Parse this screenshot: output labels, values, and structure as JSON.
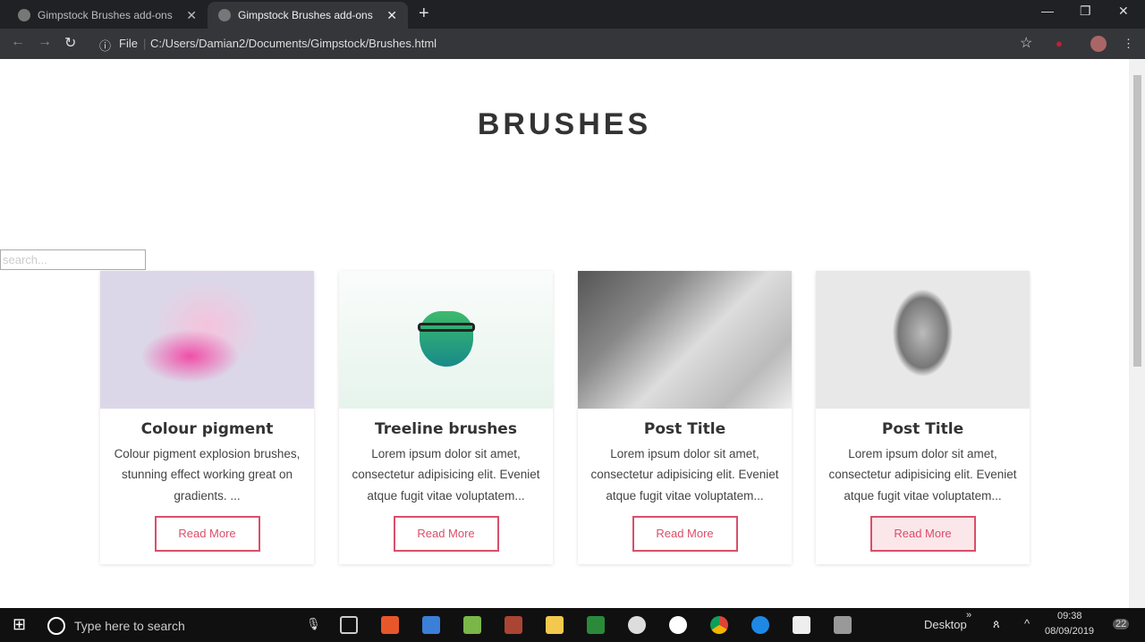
{
  "browser": {
    "tabs": [
      {
        "title": "Gimpstock Brushes add-ons"
      },
      {
        "title": "Gimpstock Brushes add-ons"
      }
    ],
    "address_scheme": "File",
    "url": "C:/Users/Damian2/Documents/Gimpstock/Brushes.html"
  },
  "page": {
    "title": "BRUSHES",
    "search_placeholder": "search...",
    "cards": [
      {
        "title": "Colour pigment",
        "text": "Colour pigment explosion brushes, stunning effect working great on gradients. ...",
        "button": "Read More"
      },
      {
        "title": "Treeline brushes",
        "text": "Lorem ipsum dolor sit amet, consectetur adipisicing elit. Eveniet atque fugit vitae voluptatem...",
        "button": "Read More"
      },
      {
        "title": "Post Title",
        "text": "Lorem ipsum dolor sit amet, consectetur adipisicing elit. Eveniet atque fugit vitae voluptatem...",
        "button": "Read More"
      },
      {
        "title": "Post Title",
        "text": "Lorem ipsum dolor sit amet, consectetur adipisicing elit. Eveniet atque fugit vitae voluptatem...",
        "button": "Read More"
      }
    ]
  },
  "taskbar": {
    "search_placeholder": "Type here to search",
    "desktop_label": "Desktop",
    "time": "09:38",
    "date": "08/09/2019",
    "notifications": "22"
  }
}
